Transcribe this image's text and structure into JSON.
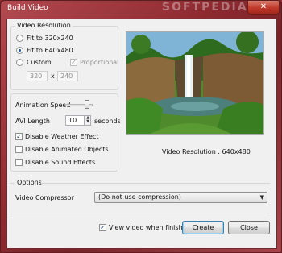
{
  "window": {
    "title": "Build Video",
    "watermark": "SOFTPEDIA",
    "close_glyph": "✕"
  },
  "resolution": {
    "legend": "Video Resolution",
    "options": [
      {
        "label": "Fit to 320x240",
        "selected": false
      },
      {
        "label": "Fit to 640x480",
        "selected": true
      },
      {
        "label": "Custom",
        "selected": false
      }
    ],
    "proportional_label": "Proportional",
    "proportional_checked": true,
    "custom_width": "320",
    "custom_height": "240",
    "times": "x"
  },
  "preview": {
    "caption": "Video Resolution : 640x480",
    "image": "waterfall-landscape"
  },
  "animation": {
    "speed_label": "Animation Speed",
    "speed_level": 0.85,
    "avi_length_label": "AVI Length",
    "avi_length_value": "10",
    "avi_length_unit": "seconds",
    "checks": [
      {
        "label": "Disable Weather Effect",
        "checked": true
      },
      {
        "label": "Disable Animated Objects",
        "checked": false
      },
      {
        "label": "Disable Sound Effects",
        "checked": false
      }
    ]
  },
  "options": {
    "legend": "Options",
    "compressor_label": "Video Compressor",
    "compressor_value": "(Do not use compression)"
  },
  "footer": {
    "view_label": "View video when finish",
    "view_checked": true,
    "create_label": "Create",
    "close_label": "Close"
  },
  "icons": {
    "checkmark": "✓",
    "spin_up": "▲",
    "spin_down": "▼",
    "dropdown": "▼"
  }
}
